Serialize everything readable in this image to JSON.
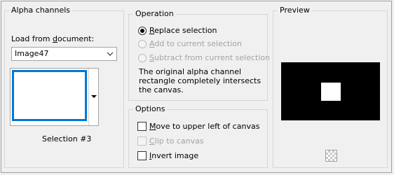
{
  "alpha_channels": {
    "title": "Alpha channels",
    "load_from_label_pre": "Load from ",
    "load_from_label_ul": "d",
    "load_from_label_post": "ocument:",
    "document_select": {
      "value": "Image47"
    },
    "thumbnail_caption": "Selection #3"
  },
  "operation": {
    "title": "Operation",
    "options": [
      {
        "label_ul": "R",
        "label_rest": "eplace selection",
        "checked": true,
        "enabled": true
      },
      {
        "label_ul": "A",
        "label_rest": "dd to current selection",
        "checked": false,
        "enabled": false
      },
      {
        "label_ul": "S",
        "label_rest": "ubtract from current selection",
        "checked": false,
        "enabled": false
      }
    ],
    "message": "The original alpha channel rectangle completely intersects the canvas."
  },
  "options": {
    "title": "Options",
    "move_upper_left": {
      "label_ul": "M",
      "label_rest": "ove to upper left of canvas",
      "checked": false,
      "enabled": true
    },
    "clip_to_canvas": {
      "label_ul": "C",
      "label_rest": "lip to canvas",
      "checked": false,
      "enabled": false
    },
    "invert_image": {
      "label_ul": "I",
      "label_rest": "nvert image",
      "checked": false,
      "enabled": true
    }
  },
  "preview": {
    "title": "Preview",
    "canvas_color": "#000000",
    "selection_color": "#ffffff"
  }
}
